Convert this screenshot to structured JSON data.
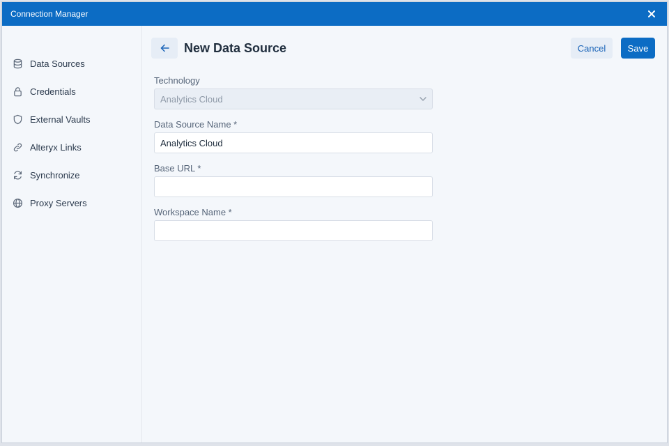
{
  "window": {
    "title": "Connection Manager"
  },
  "sidebar": {
    "items": [
      {
        "label": "Data Sources",
        "icon": "database-icon"
      },
      {
        "label": "Credentials",
        "icon": "lock-icon"
      },
      {
        "label": "External Vaults",
        "icon": "shield-icon"
      },
      {
        "label": "Alteryx Links",
        "icon": "link-icon"
      },
      {
        "label": "Synchronize",
        "icon": "sync-icon"
      },
      {
        "label": "Proxy Servers",
        "icon": "globe-icon"
      }
    ]
  },
  "header": {
    "title": "New Data Source",
    "cancel_label": "Cancel",
    "save_label": "Save"
  },
  "form": {
    "technology": {
      "label": "Technology",
      "value": "Analytics Cloud"
    },
    "data_source_name": {
      "label": "Data Source Name *",
      "value": "Analytics Cloud"
    },
    "base_url": {
      "label": "Base URL *",
      "value": ""
    },
    "workspace_name": {
      "label": "Workspace Name *",
      "value": ""
    }
  },
  "colors": {
    "accent": "#0c6cc4",
    "background": "#f4f7fb",
    "button_secondary": "#e6edf6"
  }
}
